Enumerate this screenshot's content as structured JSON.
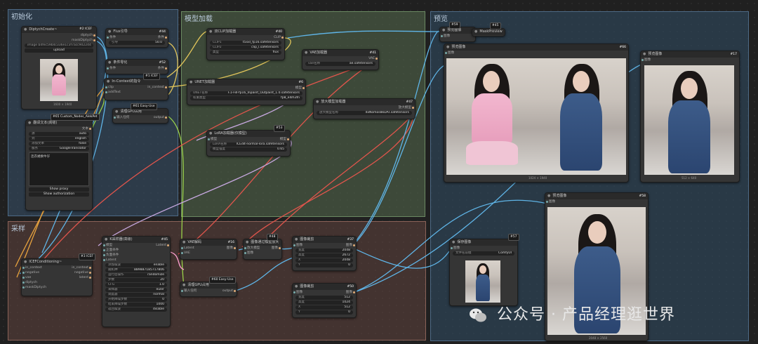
{
  "groups": {
    "init": "初始化",
    "model_load": "模型加载",
    "preview": "预览",
    "sampling": "采样"
  },
  "nodes": {
    "diptych": {
      "title": "DiptychCreate~",
      "badge": "#2 ICEF",
      "out1": "diptych",
      "out2": "maskDiptych",
      "image_label": "image",
      "image_value": "b4fec59b4c336e1c3f7acc902244",
      "upload": "upload",
      "caption": "1600 × 1940"
    },
    "flux_guidance": {
      "title": "Flux引导",
      "badge": "#44",
      "pre": "0.0",
      "in": "条件",
      "out": "条件",
      "label": "引导",
      "value": "50.0"
    },
    "cond_zero": {
      "title": "条件零化",
      "badge": "#52",
      "pre": "0.13秒",
      "in": "条件",
      "out": "条件"
    },
    "incontext": {
      "title": "In-Context的指令",
      "badge": "#1 ICEF",
      "pre": "0.13秒",
      "in": "clip",
      "out": "in_context",
      "in2": "addText"
    },
    "gpu_clean": {
      "title": "清理GPU占用",
      "badge": "#61 Easy-Use",
      "pre": "1.18秒",
      "in": "输入任何",
      "out": "output"
    },
    "translate": {
      "title": "翻译文本(高级)",
      "badge": "#65 Custom_Nodes_AlekPet",
      "pre": "0.86秒",
      "out": "文本",
      "f1": "源",
      "v1": "auto",
      "f2": "到",
      "v2": "english",
      "f3": "添加文本",
      "v3": "false",
      "f4": "服务",
      "v4": "GoogleTranslator",
      "text": "连衣裙换牛仔",
      "btn1": "Show proxy",
      "btn2": "Show authorization"
    },
    "dual_clip": {
      "title": "双CLIP加载器",
      "badge": "#40",
      "out": "CLIP",
      "f1": "CLIP1",
      "v1": "t5xxl_fp16.safetensors",
      "f2": "CLIP2",
      "v2": "clip_l.safetensors",
      "f3": "类型",
      "v3": "flux"
    },
    "vae_loader": {
      "title": "VAE加载器",
      "badge": "#41",
      "out": "VAE",
      "f1": "vae名称",
      "v1": "ae.safetensors"
    },
    "unet": {
      "title": "UNET加载器",
      "badge": "#6",
      "out": "模型",
      "f1": "UNET名称",
      "v1": "F.1-Fill-fp16_Inpaint_Outpaint_1.0.safetensors",
      "f2": "权重类型",
      "v2": "fp8_e4m3fn"
    },
    "upscale_loader": {
      "title": "放大模型加载器",
      "badge": "#47",
      "out": "放大模型",
      "f1": "放大模型名称",
      "v1": "4xNomos8kDAT.safetensors"
    },
    "lora": {
      "title": "LoRA加载器(仅模型)",
      "badge": "#53",
      "pre": "0.86秒",
      "in": "模型",
      "out": "模型",
      "f1": "LoRA名称",
      "v1": "ICEdit-normal-lora.safetensors",
      "f2": "模型强度",
      "v2": "0.65"
    },
    "preview1": {
      "title": "预览图像",
      "badge": "#59",
      "in": "图像"
    },
    "mask_preview": {
      "title": "MaskPreview",
      "badge": "#45"
    },
    "preview_main": {
      "title": "预览图像",
      "badge": "#66",
      "pre": "1.08秒",
      "in": "图像",
      "caption": "1024 × 1940"
    },
    "preview_crop": {
      "title": "预览图像",
      "badge": "#17",
      "pre": "1.43秒",
      "in": "图像",
      "caption": "512 × 640"
    },
    "preview_up": {
      "title": "预览图像",
      "badge": "#58",
      "pre": "2.07秒",
      "in": "图像",
      "caption": "2048 × 2560"
    },
    "save_image": {
      "title": "保存图像",
      "badge": "#57",
      "pre": "1.08秒",
      "in": "图像",
      "f1": "文件名前缀",
      "v1": "ComfyUI"
    },
    "icef_cond": {
      "title": "ICEFConditioning~",
      "badge": "#3 ICEF",
      "pre": "0.12秒",
      "ins": [
        "in_context",
        "negative",
        "vae",
        "diptych",
        "maskDiptych"
      ],
      "outs": [
        "in_context",
        "negative",
        "latent"
      ]
    },
    "ksampler": {
      "title": "K采样器(高级)",
      "badge": "#45",
      "pre": "13.80秒",
      "out": "Latent",
      "ins": [
        "模型",
        "正面条件",
        "负面条件",
        "Latent"
      ],
      "fields": [
        [
          "添加噪波",
          "enable"
        ],
        [
          "随机种",
          "889887185717806"
        ],
        [
          "运行后操作",
          "randomize"
        ],
        [
          "步数",
          "20"
        ],
        [
          "CFG",
          "1.0"
        ],
        [
          "采样器",
          "euler"
        ],
        [
          "调度器",
          "normal"
        ],
        [
          "开始降噪步数",
          "0"
        ],
        [
          "结束降噪步数",
          "1000"
        ],
        [
          "返回噪波",
          "disable"
        ]
      ]
    },
    "vae_decode": {
      "title": "VAE解码",
      "badge": "#16",
      "pre": "0.22秒",
      "out": "图像",
      "ins": [
        "Latent",
        "VAE"
      ]
    },
    "gpu_clean2": {
      "title": "清理GPU占用",
      "badge": "#60 Easy-Use",
      "pre": "1.08秒",
      "in": "输入任何",
      "out": "output"
    },
    "upscale": {
      "title": "图像通过模型放大",
      "badge": "#48",
      "pre": "4.13秒",
      "out": "图像",
      "ins": [
        "放大模型",
        "图像"
      ]
    },
    "crop1": {
      "title": "图像裁剪",
      "badge": "#37",
      "pre": "0.02秒",
      "in": "图像",
      "out": "图像",
      "fields": [
        [
          "宽度",
          "2048"
        ],
        [
          "高度",
          "2672"
        ],
        [
          "X",
          "2048"
        ],
        [
          "Y",
          "0"
        ]
      ]
    },
    "crop2": {
      "title": "图像裁剪",
      "badge": "#50",
      "pre": "0.12秒",
      "in": "图像",
      "out": "图像",
      "fields": [
        [
          "宽度",
          "512"
        ],
        [
          "高度",
          "1024"
        ],
        [
          "X",
          "512"
        ],
        [
          "Y",
          "0"
        ]
      ]
    }
  },
  "watermark": "公众号 · 产品经理逛世界",
  "colors": {
    "group_init": "#2b4a66",
    "group_model": "#4c6346",
    "group_preview": "#2b4a66",
    "group_sample": "#6a4a44"
  }
}
